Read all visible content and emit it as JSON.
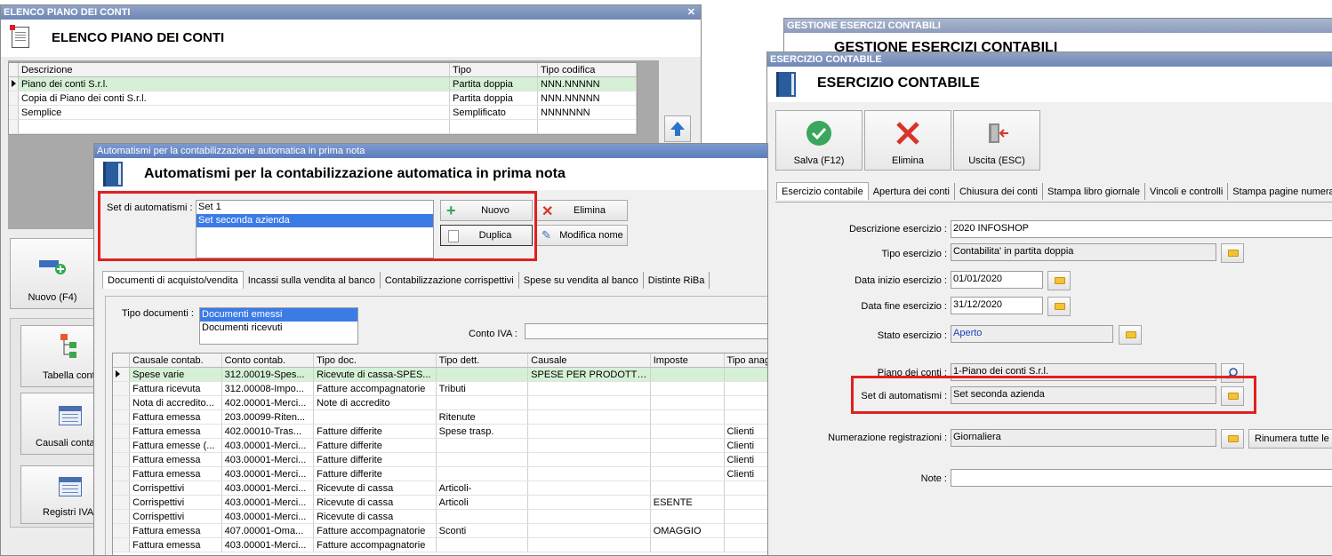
{
  "win_piano": {
    "titlebar": "ELENCO PIANO DEI CONTI",
    "header_title": "ELENCO PIANO DEI CONTI",
    "columns": [
      "Descrizione",
      "Tipo",
      "Tipo codifica"
    ],
    "rows": [
      [
        "Piano dei conti S.r.l.",
        "Partita doppia",
        "NNN.NNNNN"
      ],
      [
        "Copia di Piano dei conti S.r.l.",
        "Partita doppia",
        "NNN.NNNNN"
      ],
      [
        "Semplice",
        "Semplificato",
        "NNNNNNN"
      ]
    ],
    "side": {
      "nuovo": "Nuovo (F4)",
      "tabella": "Tabella conti",
      "causali": "Causali contab.",
      "registri": "Registri IVA"
    }
  },
  "win_gestione": {
    "titlebar": "GESTIONE ESERCIZI CONTABILI",
    "header_title": "GESTIONE ESERCIZI CONTABILI"
  },
  "win_esercizio": {
    "titlebar": "ESERCIZIO CONTABILE",
    "header_title": "ESERCIZIO CONTABILE",
    "toolbar": {
      "salva": "Salva (F12)",
      "elimina": "Elimina",
      "uscita": "Uscita (ESC)"
    },
    "tabs": [
      "Esercizio contabile",
      "Apertura dei conti",
      "Chiusura dei conti",
      "Stampa libro giornale",
      "Vincoli e controlli",
      "Stampa pagine numerate"
    ],
    "fields": {
      "descrizione_label": "Descrizione esercizio :",
      "descrizione_value": "2020 INFOSHOP",
      "tipo_label": "Tipo esercizio :",
      "tipo_value": "Contabilita' in partita doppia",
      "data_inizio_label": "Data inizio esercizio :",
      "data_inizio_value": "01/01/2020",
      "data_fine_label": "Data fine esercizio :",
      "data_fine_value": "31/12/2020",
      "stato_label": "Stato esercizio :",
      "stato_value": "Aperto",
      "piano_label": "Piano dei conti :",
      "piano_value": "1-Piano dei conti S.r.l.",
      "set_label": "Set di automatismi :",
      "set_value": "Set seconda azienda",
      "numerazione_label": "Numerazione registrazioni :",
      "numerazione_value": "Giornaliera",
      "rinumera_button": "Rinumera tutte le",
      "note_label": "Note :",
      "note_value": ""
    }
  },
  "win_auto": {
    "titlebar": "Automatismi per la contabilizzazione automatica in prima nota",
    "header_title": "Automatismi per la contabilizzazione automatica in prima nota",
    "set_label": "Set di automatismi :",
    "set_items": [
      "Set 1",
      "Set seconda azienda"
    ],
    "buttons": {
      "nuovo": "Nuovo",
      "duplica": "Duplica",
      "elimina": "Elimina",
      "modifica": "Modifica nome"
    },
    "tabs": [
      "Documenti di acquisto/vendita",
      "Incassi sulla vendita al banco",
      "Contabilizzazione corrispettivi",
      "Spese su vendita al banco",
      "Distinte RiBa"
    ],
    "tipo_documenti_label": "Tipo documenti :",
    "tipo_documenti_items": [
      "Documenti emessi",
      "Documenti ricevuti"
    ],
    "conto_iva_label": "Conto IVA :",
    "columns": [
      "Causale contab.",
      "Conto contab.",
      "Tipo doc.",
      "Tipo dett.",
      "Causale",
      "Imposte",
      "Tipo anag."
    ],
    "rows": [
      [
        "Spese varie",
        "312.00019-Spes...",
        "Ricevute di cassa-SPES...",
        "",
        "SPESE PER PRODOTTI ...",
        "",
        ""
      ],
      [
        "Fattura ricevuta",
        "312.00008-Impo...",
        "Fatture accompagnatorie",
        "Tributi",
        "",
        "",
        ""
      ],
      [
        "Nota di accredito...",
        "402.00001-Merci...",
        "Note di accredito",
        "",
        "",
        "",
        ""
      ],
      [
        "Fattura emessa",
        "203.00099-Riten...",
        "",
        "Ritenute",
        "",
        "",
        ""
      ],
      [
        "Fattura emessa",
        "402.00010-Tras...",
        "Fatture differite",
        "Spese trasp.",
        "",
        "",
        "Clienti"
      ],
      [
        "Fattura emesse (...",
        "403.00001-Merci...",
        "Fatture differite",
        "",
        "",
        "",
        "Clienti"
      ],
      [
        "Fattura emessa",
        "403.00001-Merci...",
        "Fatture differite",
        "",
        "",
        "",
        "Clienti"
      ],
      [
        "Fattura emessa",
        "403.00001-Merci...",
        "Fatture differite",
        "",
        "",
        "",
        "Clienti"
      ],
      [
        "Corrispettivi",
        "403.00001-Merci...",
        "Ricevute di cassa",
        "Articoli-",
        "",
        "",
        ""
      ],
      [
        "Corrispettivi",
        "403.00001-Merci...",
        "Ricevute di cassa",
        "Articoli",
        "",
        "ESENTE",
        ""
      ],
      [
        "Corrispettivi",
        "403.00001-Merci...",
        "Ricevute di cassa",
        "",
        "",
        "",
        ""
      ],
      [
        "Fattura emessa",
        "407.00001-Oma...",
        "Fatture accompagnatorie",
        "Sconti",
        "",
        "OMAGGIO",
        ""
      ],
      [
        "Fattura emessa",
        "403.00001-Merci...",
        "Fatture accompagnatorie",
        "",
        "",
        "",
        ""
      ]
    ]
  },
  "colors": {
    "highlight_row": "#d6f0d6",
    "selection": "#3b7be6",
    "annotation": "#e02020"
  }
}
